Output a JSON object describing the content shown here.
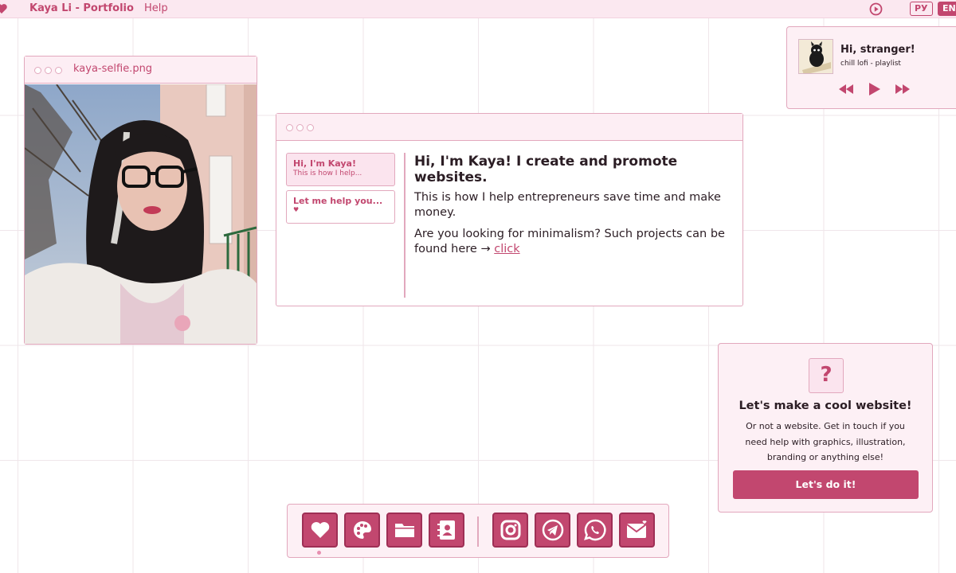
{
  "menubar": {
    "brand": "Kaya Li - Portfolio",
    "help": "Help",
    "lang_ru": "РУ",
    "lang_en": "EN",
    "play_icon": "play-circle-icon"
  },
  "photo_window": {
    "title": "kaya-selfie.png"
  },
  "about_window": {
    "tabs": [
      {
        "title": "Hi, I'm Kaya!",
        "subtitle": "This is how I help..."
      },
      {
        "title": "Let me help you...",
        "subtitle": "♥"
      }
    ],
    "heading": "Hi, I'm Kaya! I create and promote websites.",
    "paragraph1": "This is how I help entrepreneurs save time and make money.",
    "paragraph2_prefix": "Are you looking for minimalism? Such projects can be found here →",
    "link": "click"
  },
  "player": {
    "title": "Hi, stranger!",
    "subtitle": "chill lofi - playlist"
  },
  "cta": {
    "icon_text": "?",
    "title": "Let's make a cool website!",
    "text": "Or not a website. Get in touch if you need help with graphics, illustration, branding or anything else!",
    "button": "Let's do it!"
  },
  "dock": {
    "icons": [
      "heart-icon",
      "palette-icon",
      "folder-icon",
      "contacts-icon",
      "instagram-icon",
      "telegram-icon",
      "whatsapp-icon",
      "mail-icon"
    ]
  },
  "colors": {
    "accent": "#c2476f",
    "panel": "#fdf0f5",
    "border": "#e2a8bd"
  }
}
